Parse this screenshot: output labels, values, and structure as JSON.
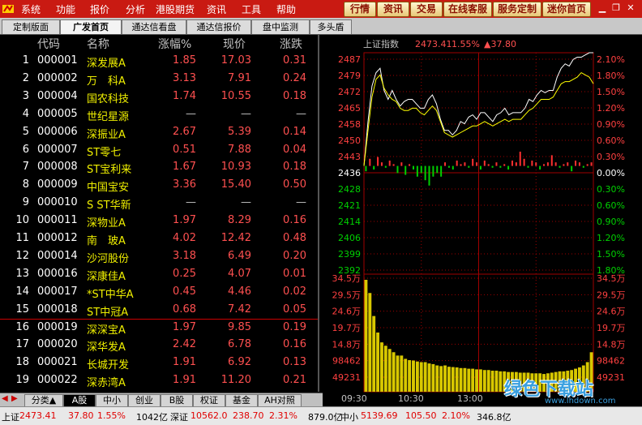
{
  "menubar": {
    "items": [
      "系统",
      "功能",
      "报价",
      "分析",
      "港股期货",
      "资讯",
      "工具",
      "帮助"
    ],
    "right_buttons": [
      "行情",
      "资讯",
      "交易",
      "在线客服",
      "服务定制",
      "迷你首页"
    ],
    "window_controls": [
      "minimize-icon",
      "restore-icon",
      "close-icon"
    ]
  },
  "tabs": [
    "定制版面",
    "广发首页",
    "通达信看盘",
    "通达信报价",
    "盘中监测",
    "多头盾"
  ],
  "active_tab": 1,
  "list": {
    "headers": [
      "代码",
      "名称",
      "涨幅%",
      "现价",
      "涨跌"
    ],
    "rows": [
      {
        "idx": "1",
        "code": "000001",
        "name": "深发展A",
        "pct": "1.85",
        "price": "17.03",
        "chg": "0.31"
      },
      {
        "idx": "2",
        "code": "000002",
        "name": "万　科A",
        "pct": "3.13",
        "price": "7.91",
        "chg": "0.24"
      },
      {
        "idx": "3",
        "code": "000004",
        "name": "国农科技",
        "pct": "1.74",
        "price": "10.55",
        "chg": "0.18"
      },
      {
        "idx": "4",
        "code": "000005",
        "name": "世纪星源",
        "pct": "—",
        "price": "—",
        "chg": "—"
      },
      {
        "idx": "5",
        "code": "000006",
        "name": "深振业A",
        "pct": "2.67",
        "price": "5.39",
        "chg": "0.14"
      },
      {
        "idx": "6",
        "code": "000007",
        "name": "ST零七",
        "pct": "0.51",
        "price": "7.88",
        "chg": "0.04"
      },
      {
        "idx": "7",
        "code": "000008",
        "name": "ST宝利来",
        "pct": "1.67",
        "price": "10.93",
        "chg": "0.18"
      },
      {
        "idx": "8",
        "code": "000009",
        "name": "中国宝安",
        "pct": "3.36",
        "price": "15.40",
        "chg": "0.50"
      },
      {
        "idx": "9",
        "code": "000010",
        "name": "S ST华新",
        "pct": "—",
        "price": "—",
        "chg": "—"
      },
      {
        "idx": "10",
        "code": "000011",
        "name": "深物业A",
        "pct": "1.97",
        "price": "8.29",
        "chg": "0.16"
      },
      {
        "idx": "11",
        "code": "000012",
        "name": "南　玻A",
        "pct": "4.02",
        "price": "12.42",
        "chg": "0.48"
      },
      {
        "idx": "12",
        "code": "000014",
        "name": "沙河股份",
        "pct": "3.18",
        "price": "6.49",
        "chg": "0.20"
      },
      {
        "idx": "13",
        "code": "000016",
        "name": "深康佳A",
        "pct": "0.25",
        "price": "4.07",
        "chg": "0.01"
      },
      {
        "idx": "14",
        "code": "000017",
        "name": "*ST中华A",
        "pct": "0.45",
        "price": "4.46",
        "chg": "0.02"
      },
      {
        "idx": "15",
        "code": "000018",
        "name": "ST中冠A",
        "pct": "0.68",
        "price": "7.42",
        "chg": "0.05"
      },
      {
        "idx": "16",
        "code": "000019",
        "name": "深深宝A",
        "pct": "1.97",
        "price": "9.85",
        "chg": "0.19"
      },
      {
        "idx": "17",
        "code": "000020",
        "name": "深华发A",
        "pct": "2.42",
        "price": "6.78",
        "chg": "0.16"
      },
      {
        "idx": "18",
        "code": "000021",
        "name": "长城开发",
        "pct": "1.91",
        "price": "6.92",
        "chg": "0.13"
      },
      {
        "idx": "19",
        "code": "000022",
        "name": "深赤湾A",
        "pct": "1.91",
        "price": "11.20",
        "chg": "0.21"
      }
    ]
  },
  "bottom_tabs": [
    "分类▲",
    "A股",
    "中小",
    "创业",
    "B股",
    "权证",
    "基金",
    "AH对照"
  ],
  "active_bottom_tab": 1,
  "chart_data": {
    "type": "line",
    "title": "上证指数",
    "last_value": "2473.41",
    "change_pct": "1.55%",
    "change_abs": "▲37.80",
    "y_left_ticks": [
      "2487",
      "2479",
      "2472",
      "2465",
      "2458",
      "2450",
      "2443",
      "2436",
      "2428",
      "2421",
      "2414",
      "2406",
      "2399",
      "2392"
    ],
    "y_right_ticks": [
      "2.10%",
      "1.80%",
      "1.50%",
      "1.20%",
      "0.90%",
      "0.60%",
      "0.30%",
      "0.00%",
      "0.30%",
      "0.60%",
      "0.90%",
      "1.20%",
      "1.50%",
      "1.80%"
    ],
    "prev_close": 2436,
    "ylim": [
      2392,
      2487
    ],
    "vol_left_ticks": [
      "34.5万",
      "29.5万",
      "24.6万",
      "19.7万",
      "14.8万",
      "98462",
      "49231"
    ],
    "vol_right_ticks": [
      "34.5万",
      "29.5万",
      "24.6万",
      "19.7万",
      "14.8万",
      "98462",
      "49231"
    ],
    "vol_ylim": [
      0,
      345000
    ],
    "x_ticks": [
      "09:30",
      "10:30",
      "13:00"
    ],
    "series": [
      {
        "values": [
          2436,
          2456,
          2472,
          2478,
          2480,
          2470,
          2466,
          2470,
          2466,
          2463,
          2465,
          2466,
          2466,
          2464,
          2462,
          2462,
          2466,
          2468,
          2464,
          2457,
          2452,
          2452,
          2450,
          2452,
          2456,
          2455,
          2458,
          2459,
          2457,
          2460,
          2460,
          2458,
          2456,
          2459,
          2460,
          2462,
          2459,
          2460,
          2460,
          2460,
          2462,
          2466,
          2465,
          2468,
          2470,
          2469,
          2470,
          2470,
          2476,
          2480,
          2482,
          2481,
          2484,
          2485,
          2485,
          2486,
          2487,
          2487
        ]
      },
      {
        "values": [
          2436,
          2452,
          2467,
          2475,
          2477,
          2471,
          2468,
          2466,
          2465,
          2462,
          2461,
          2461,
          2462,
          2462,
          2460,
          2459,
          2461,
          2463,
          2461,
          2456,
          2451,
          2450,
          2449,
          2450,
          2451,
          2452,
          2453,
          2454,
          2454,
          2455,
          2456,
          2455,
          2454,
          2455,
          2456,
          2457,
          2456,
          2457,
          2457,
          2457,
          2459,
          2461,
          2462,
          2464,
          2466,
          2466,
          2466,
          2467,
          2470,
          2473,
          2474,
          2474,
          2475,
          2476,
          2478,
          2477,
          2476,
          2473
        ]
      }
    ],
    "bars": [
      -3,
      4,
      -2,
      5,
      2,
      -1,
      3,
      1,
      -4,
      2,
      -5,
      1,
      -2,
      -6,
      -4,
      -8,
      -11,
      -6,
      -4,
      -6,
      2,
      -1,
      -2,
      3,
      1,
      2,
      -1,
      4,
      2,
      -2,
      3,
      1,
      -1,
      2,
      -1,
      1,
      -2,
      3,
      2,
      8,
      4,
      -1,
      3,
      2,
      -2,
      1,
      2,
      6,
      2,
      -1,
      1,
      2,
      -3,
      3,
      2,
      -1,
      1,
      2
    ],
    "volume": [
      340000,
      300000,
      230000,
      180000,
      150000,
      140000,
      130000,
      120000,
      110000,
      110000,
      100000,
      96000,
      95000,
      92000,
      90000,
      90000,
      86000,
      84000,
      80000,
      78000,
      80000,
      76000,
      75000,
      74000,
      72000,
      72000,
      70000,
      70000,
      68000,
      68000,
      66000,
      66000,
      64000,
      64000,
      62000,
      62000,
      60000,
      60000,
      60000,
      58000,
      58000,
      58000,
      56000,
      56000,
      56000,
      54000,
      56000,
      58000,
      60000,
      62000,
      62000,
      64000,
      66000,
      70000,
      74000,
      80000,
      90000,
      120000
    ]
  },
  "status": {
    "sh_label": "上证",
    "sh_value": "2473.41",
    "sh_chg": "37.80",
    "sh_pct": "1.55%",
    "sh_amt": "1042亿",
    "sz_label": "深证",
    "sz_value": "10562.0",
    "sz_chg": "238.70",
    "sz_pct": "2.31%",
    "sz_amt": "879.0亿",
    "zx_label": "中小",
    "zx_value": "5139.69",
    "zx_chg": "105.50",
    "zx_pct": "2.10%",
    "zx_amt": "346.8亿"
  },
  "watermark": {
    "text": "绿色下载站",
    "sub": "www.lhdown.com"
  }
}
